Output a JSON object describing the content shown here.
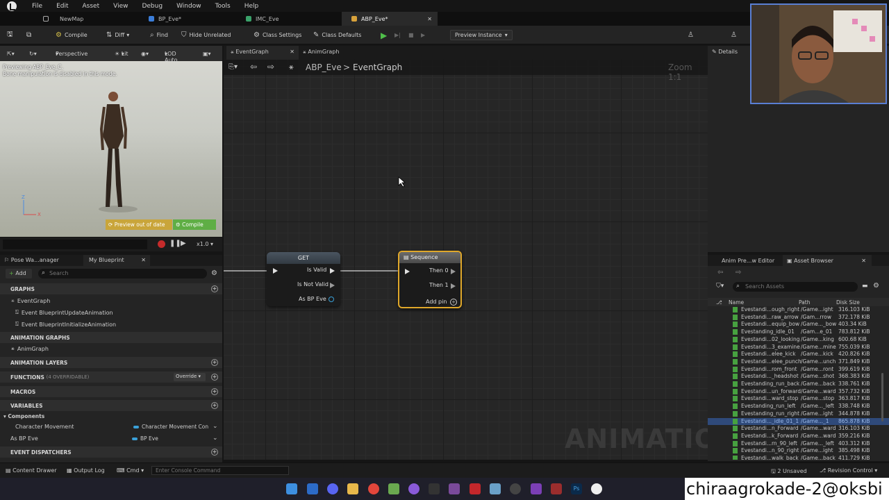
{
  "menu": [
    "File",
    "Edit",
    "Asset",
    "View",
    "Debug",
    "Window",
    "Tools",
    "Help"
  ],
  "doc_tabs": [
    {
      "label": "NewMap"
    },
    {
      "label": "BP_Eve*"
    },
    {
      "label": "IMC_Eve"
    },
    {
      "label": "ABP_Eve*",
      "active": true
    }
  ],
  "toolbar": {
    "compile": "Compile",
    "diff": "Diff",
    "find": "Find",
    "hide_unrelated": "Hide Unrelated",
    "class_settings": "Class Settings",
    "class_defaults": "Class Defaults",
    "preview_instance": "Preview Instance"
  },
  "viewport": {
    "perspective": "Perspective",
    "lit": "Lit",
    "lod": "LOD Auto",
    "preview_line1": "Previewing ABP_Eve_C.",
    "preview_line2": "Bone manipulation is disabled in this mode.",
    "out_of_date": "Preview out of date",
    "compile_chip": "Compile",
    "speed": "x1.0",
    "axis_z": "Z",
    "axis_x": "X"
  },
  "left_tabs": {
    "pose": "Pose Wa...anager",
    "my_blueprint": "My Blueprint"
  },
  "my_blueprint": {
    "add": "Add",
    "search_placeholder": "Search",
    "graphs": "GRAPHS",
    "event_graph": "EventGraph",
    "ev_update": "Event BlueprintUpdateAnimation",
    "ev_init": "Event BlueprintInitializeAnimation",
    "anim_graphs": "ANIMATION GRAPHS",
    "anim_graph": "AnimGraph",
    "anim_layers": "ANIMATION LAYERS",
    "functions": "FUNCTIONS",
    "functions_sub": "(4 OVERRIDABLE)",
    "override": "Override",
    "macros": "MACROS",
    "variables": "VARIABLES",
    "components": "Components",
    "var1_name": "Character Movement",
    "var1_type": "Character Movement Con",
    "var2_name": "As BP Eve",
    "var2_type": "BP Eve",
    "dispatchers": "EVENT DISPATCHERS"
  },
  "graph_tabs": {
    "event_graph": "EventGraph",
    "anim_graph": "AnimGraph"
  },
  "breadcrumb": {
    "root": "ABP_Eve",
    "sep": ">",
    "leaf": "EventGraph",
    "zoom": "Zoom 1:1"
  },
  "nodes": {
    "get": {
      "title": "GET",
      "pin_valid": "Is Valid",
      "pin_not_valid": "Is Not Valid",
      "pin_out": "As BP Eve"
    },
    "sequence": {
      "title": "Sequence",
      "then0": "Then 0",
      "then1": "Then 1",
      "add_pin": "Add pin"
    }
  },
  "watermark": "ANIMATION",
  "details": {
    "title": "Details"
  },
  "bottom_right_tabs": {
    "anim_preview": "Anim Pre...w Editor",
    "asset_browser": "Asset Browser"
  },
  "asset_browser": {
    "search_placeholder": "Search Assets",
    "columns": {
      "name": "Name",
      "path": "Path",
      "size": "Disk Size"
    },
    "rows": [
      {
        "name": "Evestandi...ough_right",
        "path": "/Game...ight",
        "size": "316.103 KiB"
      },
      {
        "name": "Evestandi...raw_arrow",
        "path": "/Gam...rrow",
        "size": "372.178 KiB"
      },
      {
        "name": "Evestandi...equip_bow",
        "path": "/Game..._bow",
        "size": "403.34 KiB"
      },
      {
        "name": "Evestanding_idle_01",
        "path": "/Gam...e_01",
        "size": "783.812 KiB"
      },
      {
        "name": "Evestandi...02_looking",
        "path": "/Game...king",
        "size": "600.68 KiB"
      },
      {
        "name": "Evestandi...3_examine",
        "path": "/Game...mine",
        "size": "755.039 KiB"
      },
      {
        "name": "Evestandi...elee_kick",
        "path": "/Game...kick",
        "size": "420.826 KiB"
      },
      {
        "name": "Evestandi...elee_punch",
        "path": "/Game...unch",
        "size": "371.849 KiB"
      },
      {
        "name": "Evestandi...rom_front",
        "path": "/Game...ront",
        "size": "399.619 KiB"
      },
      {
        "name": "Evestandi..._headshot",
        "path": "/Game...shot",
        "size": "368.383 KiB"
      },
      {
        "name": "Evestanding_run_back",
        "path": "/Game...back",
        "size": "338.761 KiB"
      },
      {
        "name": "Evestandi...un_forward",
        "path": "/Game...ward",
        "size": "357.732 KiB"
      },
      {
        "name": "Evestandi...ward_stop",
        "path": "/Game...stop",
        "size": "363.817 KiB"
      },
      {
        "name": "Evestanding_run_left",
        "path": "/Game..._left",
        "size": "338.748 KiB"
      },
      {
        "name": "Evestanding_run_right",
        "path": "/Game...ight",
        "size": "344.878 KiB"
      },
      {
        "name": "Evestandi..._idle_01_1",
        "path": "/Game..._1",
        "size": "865.878 KiB",
        "selected": true
      },
      {
        "name": "Evestandi...n_Forward",
        "path": "/Game...ward",
        "size": "316.103 KiB"
      },
      {
        "name": "Evestandi...k_Forward",
        "path": "/Game...ward",
        "size": "359.216 KiB"
      },
      {
        "name": "Evestandi...rn_90_left",
        "path": "/Game..._left",
        "size": "403.312 KiB"
      },
      {
        "name": "Evestandi...n_90_right",
        "path": "/Game...ight",
        "size": "385.498 KiB"
      },
      {
        "name": "Evestandi...walk_back",
        "path": "/Game...back",
        "size": "411.729 KiB"
      }
    ]
  },
  "status": {
    "content_drawer": "Content Drawer",
    "output_log": "Output Log",
    "cmd": "Cmd",
    "console_placeholder": "Enter Console Command",
    "unsaved": "2 Unsaved",
    "revision": "Revision Control"
  },
  "ticker": "chiraagrokade-2@oksbi"
}
